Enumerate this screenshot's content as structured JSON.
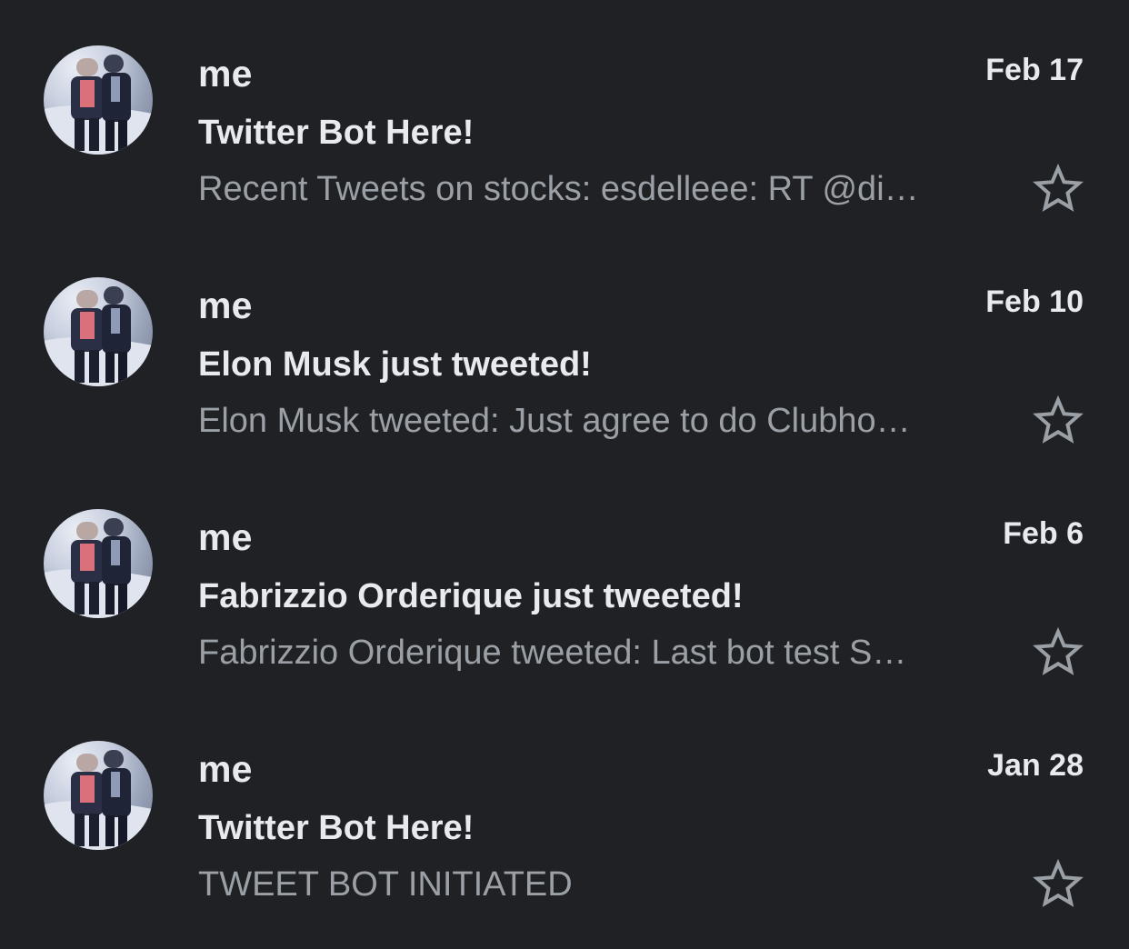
{
  "emails": [
    {
      "sender": "me",
      "date": "Feb 17",
      "subject": "Twitter Bot Here!",
      "snippet": "Recent Tweets on stocks: esdelleee: RT @di…"
    },
    {
      "sender": "me",
      "date": "Feb 10",
      "subject": "Elon Musk just tweeted!",
      "snippet": "Elon Musk tweeted: Just agree to do Clubho…"
    },
    {
      "sender": "me",
      "date": "Feb 6",
      "subject": "Fabrizzio Orderique just tweeted!",
      "snippet": "Fabrizzio Orderique tweeted: Last bot test S…"
    },
    {
      "sender": "me",
      "date": "Jan 28",
      "subject": "Twitter Bot Here!",
      "snippet": "TWEET BOT INITIATED"
    }
  ],
  "colors": {
    "background": "#202124",
    "primary_text": "#e8eaed",
    "secondary_text": "#9aa0a6",
    "star_outline": "#9aa0a6"
  },
  "icons": {
    "star": "star-outline-icon",
    "avatar": "sender-avatar-photo"
  }
}
